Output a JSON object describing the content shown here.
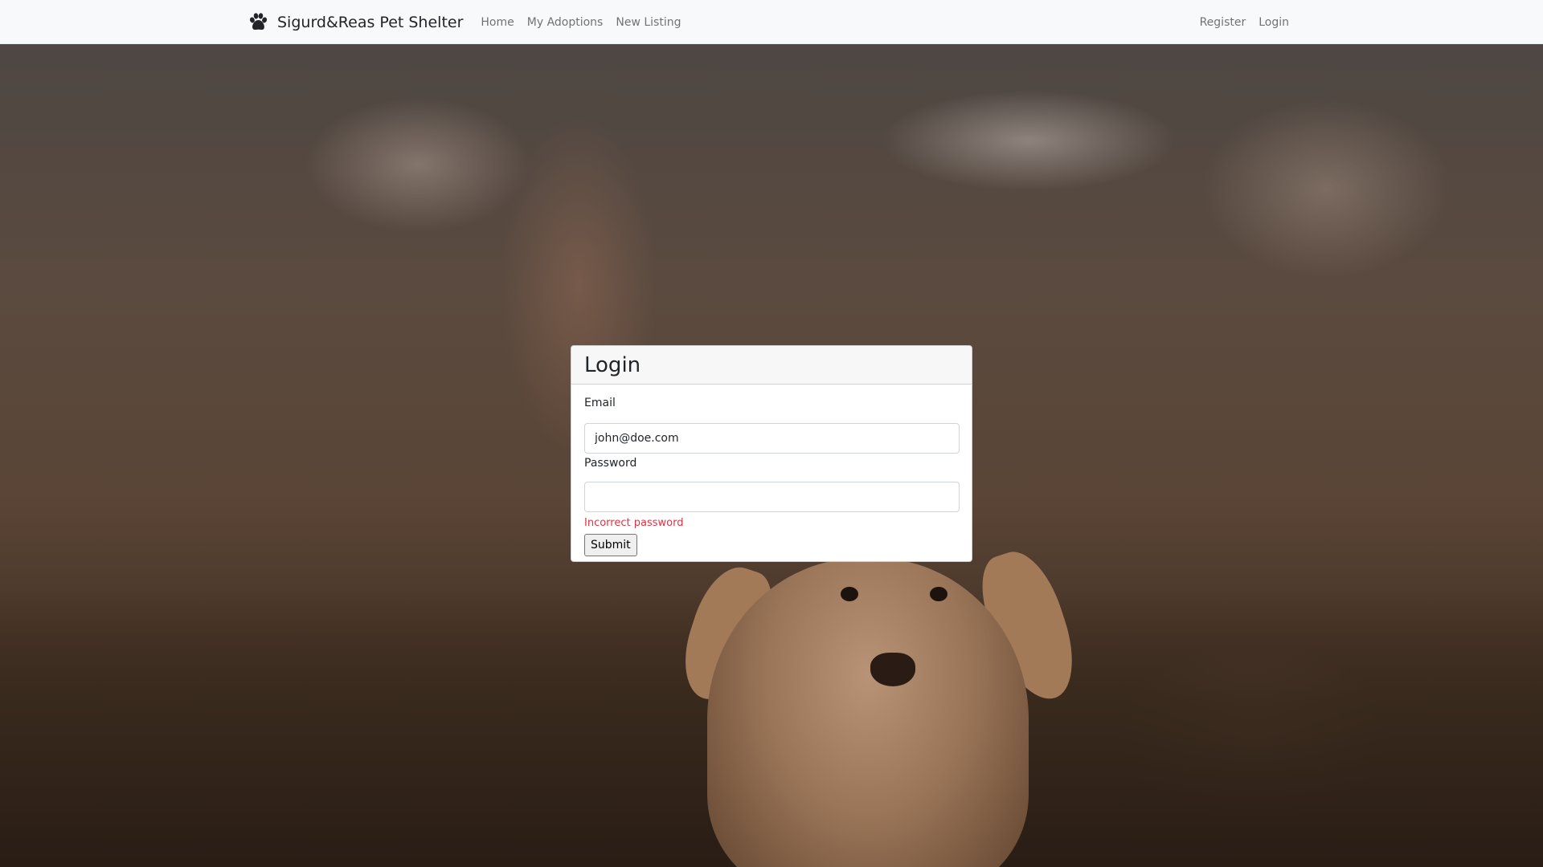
{
  "navbar": {
    "brand": "Sigurd&Reas Pet Shelter",
    "brand_icon": "paw-icon",
    "links": [
      "Home",
      "My Adoptions",
      "New Listing"
    ],
    "right_links": [
      "Register",
      "Login"
    ]
  },
  "login": {
    "title": "Login",
    "email_label": "Email",
    "email_value": "john@doe.com",
    "password_label": "Password",
    "password_value": "",
    "error": "Incorrect password",
    "submit_label": "Submit"
  },
  "colors": {
    "navbar_bg": "#f8f9fa",
    "error": "#dc3545"
  }
}
